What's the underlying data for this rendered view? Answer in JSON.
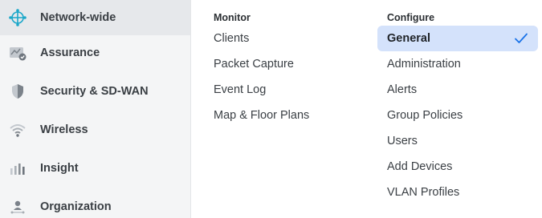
{
  "sidebar": {
    "items": [
      {
        "label": "Network-wide",
        "icon": "network-globe-icon",
        "active": true
      },
      {
        "label": "Assurance",
        "icon": "assurance-chart-icon",
        "active": false
      },
      {
        "label": "Security & SD-WAN",
        "icon": "shield-icon",
        "active": false
      },
      {
        "label": "Wireless",
        "icon": "wifi-icon",
        "active": false
      },
      {
        "label": "Insight",
        "icon": "bar-chart-icon",
        "active": false
      },
      {
        "label": "Organization",
        "icon": "organization-icon",
        "active": false
      }
    ]
  },
  "monitor": {
    "heading": "Monitor",
    "items": [
      "Clients",
      "Packet Capture",
      "Event Log",
      "Map & Floor Plans"
    ]
  },
  "configure": {
    "heading": "Configure",
    "items": [
      "General",
      "Administration",
      "Alerts",
      "Group Policies",
      "Users",
      "Add Devices",
      "VLAN Profiles"
    ],
    "selected": "General"
  },
  "colors": {
    "accent": "#1a73e8",
    "selected_bg": "#d4e2fb",
    "brand_teal": "#1aa7c9"
  }
}
